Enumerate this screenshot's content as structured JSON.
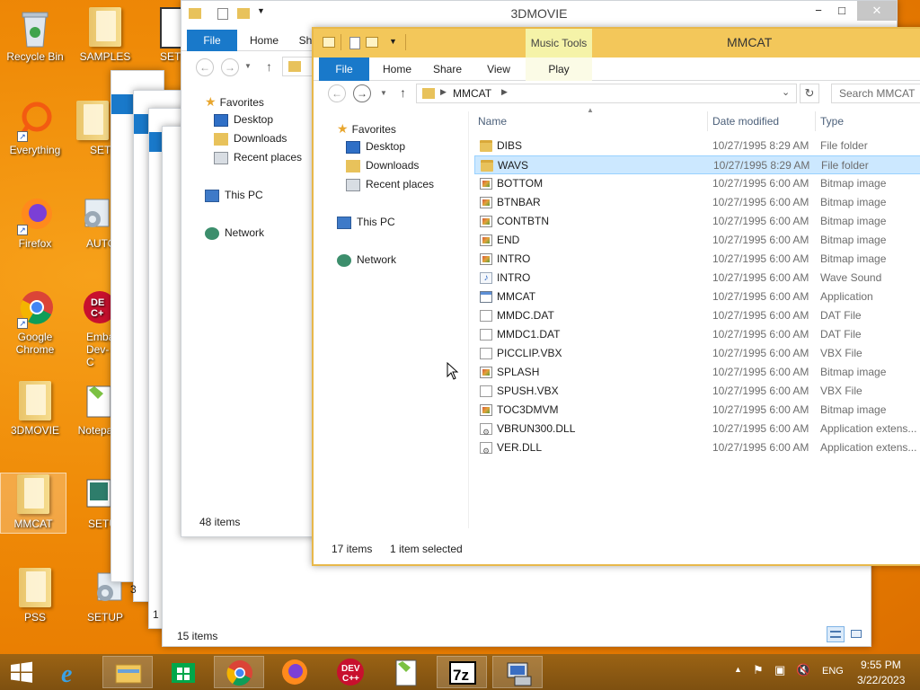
{
  "desktop": {
    "icons_col1": [
      {
        "label": "Recycle Bin",
        "icon": "recycle-bin-icon"
      },
      {
        "label": "Everything",
        "icon": "everything-icon"
      },
      {
        "label": "Firefox",
        "icon": "firefox-icon"
      },
      {
        "label": "Google Chrome",
        "icon": "chrome-icon"
      },
      {
        "label": "3DMOVIE",
        "icon": "folder-icon"
      },
      {
        "label": "MMCAT",
        "icon": "folder-icon"
      },
      {
        "label": "PSS",
        "icon": "folder-icon"
      }
    ],
    "icons_col2": [
      {
        "label": "SAMPLES",
        "icon": "folder-icon"
      },
      {
        "label": "SETU",
        "icon": "folder-icon"
      },
      {
        "label": "AUTO",
        "icon": "setup-icon"
      },
      {
        "label": "Embarc Dev-C",
        "icon": "devcpp-icon"
      },
      {
        "label": "Notepa",
        "icon": "notepad-icon"
      },
      {
        "label": "SETU",
        "icon": "setup-icon"
      },
      {
        "label": "SETUP",
        "icon": "setup-icon"
      }
    ],
    "partial_top": "SETU"
  },
  "back_window": {
    "title": "3DMOVIE",
    "tabs": [
      "File",
      "Home",
      "Sh"
    ],
    "nav": {
      "favorites": "Favorites",
      "desktop": "Desktop",
      "downloads": "Downloads",
      "recent": "Recent places",
      "this_pc": "This PC",
      "network": "Network"
    },
    "status_items": "48 items"
  },
  "bottom_window": {
    "status_items": "15 items",
    "partial_left_a": "3",
    "partial_left_b": "1"
  },
  "front_window": {
    "title": "MMCAT",
    "context_tab": "Music Tools",
    "tabs": {
      "file": "File",
      "home": "Home",
      "share": "Share",
      "view": "View",
      "play": "Play"
    },
    "address": {
      "crumb": "MMCAT"
    },
    "search_placeholder": "Search MMCAT",
    "nav": {
      "favorites": "Favorites",
      "desktop": "Desktop",
      "downloads": "Downloads",
      "recent": "Recent places",
      "this_pc": "This PC",
      "network": "Network"
    },
    "columns": {
      "name": "Name",
      "date": "Date modified",
      "type": "Type"
    },
    "files": [
      {
        "name": "DIBS",
        "date": "10/27/1995 8:29 AM",
        "type": "File folder",
        "icon": "folder"
      },
      {
        "name": "WAVS",
        "date": "10/27/1995 8:29 AM",
        "type": "File folder",
        "icon": "folder"
      },
      {
        "name": "BOTTOM",
        "date": "10/27/1995 6:00 AM",
        "type": "Bitmap image",
        "icon": "bmp"
      },
      {
        "name": "BTNBAR",
        "date": "10/27/1995 6:00 AM",
        "type": "Bitmap image",
        "icon": "bmp"
      },
      {
        "name": "CONTBTN",
        "date": "10/27/1995 6:00 AM",
        "type": "Bitmap image",
        "icon": "bmp"
      },
      {
        "name": "END",
        "date": "10/27/1995 6:00 AM",
        "type": "Bitmap image",
        "icon": "bmp"
      },
      {
        "name": "INTRO",
        "date": "10/27/1995 6:00 AM",
        "type": "Bitmap image",
        "icon": "bmp"
      },
      {
        "name": "INTRO",
        "date": "10/27/1995 6:00 AM",
        "type": "Wave Sound",
        "icon": "wav"
      },
      {
        "name": "MMCAT",
        "date": "10/27/1995 6:00 AM",
        "type": "Application",
        "icon": "app"
      },
      {
        "name": "MMDC.DAT",
        "date": "10/27/1995 6:00 AM",
        "type": "DAT File",
        "icon": "doc"
      },
      {
        "name": "MMDC1.DAT",
        "date": "10/27/1995 6:00 AM",
        "type": "DAT File",
        "icon": "doc"
      },
      {
        "name": "PICCLIP.VBX",
        "date": "10/27/1995 6:00 AM",
        "type": "VBX File",
        "icon": "doc"
      },
      {
        "name": "SPLASH",
        "date": "10/27/1995 6:00 AM",
        "type": "Bitmap image",
        "icon": "bmp"
      },
      {
        "name": "SPUSH.VBX",
        "date": "10/27/1995 6:00 AM",
        "type": "VBX File",
        "icon": "doc"
      },
      {
        "name": "TOC3DMVM",
        "date": "10/27/1995 6:00 AM",
        "type": "Bitmap image",
        "icon": "bmp"
      },
      {
        "name": "VBRUN300.DLL",
        "date": "10/27/1995 6:00 AM",
        "type": "Application extens...",
        "icon": "dll"
      },
      {
        "name": "VER.DLL",
        "date": "10/27/1995 6:00 AM",
        "type": "Application extens...",
        "icon": "dll"
      }
    ],
    "selected_index": 1,
    "status": {
      "items": "17 items",
      "selected": "1 item selected"
    }
  },
  "taskbar": {
    "apps": [
      "start",
      "internet-explorer",
      "file-explorer",
      "store",
      "chrome",
      "firefox",
      "devcpp",
      "notepadpp",
      "7zip",
      "vb-setup"
    ],
    "tray": {
      "lang": "ENG",
      "time": "9:55 PM",
      "date": "3/22/2023"
    }
  },
  "colors": {
    "accent": "#1979ca",
    "context_tab": "#f5f3a8",
    "selection": "#cce8ff",
    "frame": "#e8b84a"
  }
}
